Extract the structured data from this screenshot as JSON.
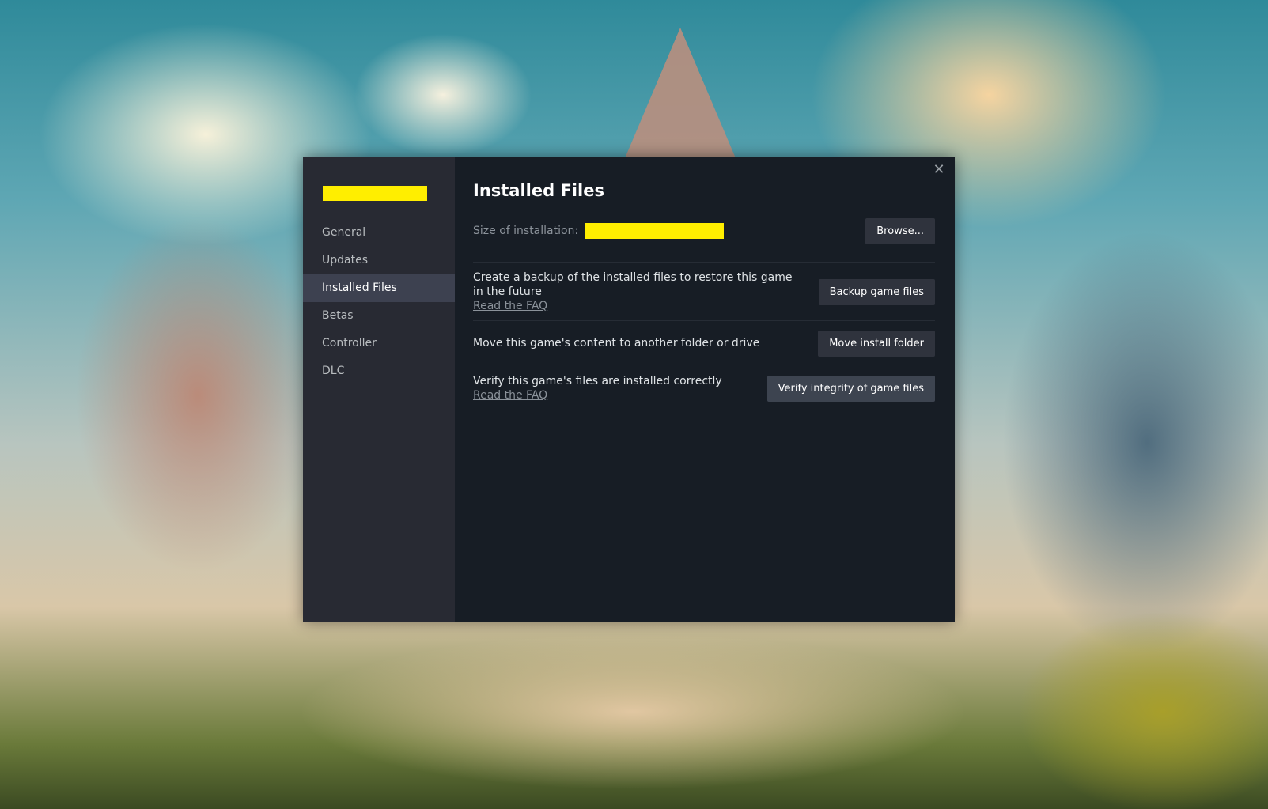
{
  "dialog": {
    "game_title_redacted": "",
    "close_icon": "close-icon",
    "title": "Installed Files"
  },
  "sidebar": {
    "items": [
      {
        "label": "General",
        "active": false
      },
      {
        "label": "Updates",
        "active": false
      },
      {
        "label": "Installed Files",
        "active": true
      },
      {
        "label": "Betas",
        "active": false
      },
      {
        "label": "Controller",
        "active": false
      },
      {
        "label": "DLC",
        "active": false
      }
    ]
  },
  "main": {
    "size_label": "Size of installation:",
    "size_value_redacted": "",
    "browse_label": "Browse...",
    "rows": [
      {
        "text": "Create a backup of the installed files to restore this game in the future",
        "link": "Read the FAQ",
        "button": "Backup game files"
      },
      {
        "text": "Move this game's content to another folder or drive",
        "button": "Move install folder"
      },
      {
        "text": "Verify this game's files are installed correctly",
        "link": "Read the FAQ",
        "button": "Verify integrity of game files"
      }
    ]
  },
  "colors": {
    "highlight_redaction": "#ffee00",
    "dialog_bg": "#171d25",
    "sidebar_bg": "#282a33",
    "active_item_bg": "#3d4150"
  }
}
